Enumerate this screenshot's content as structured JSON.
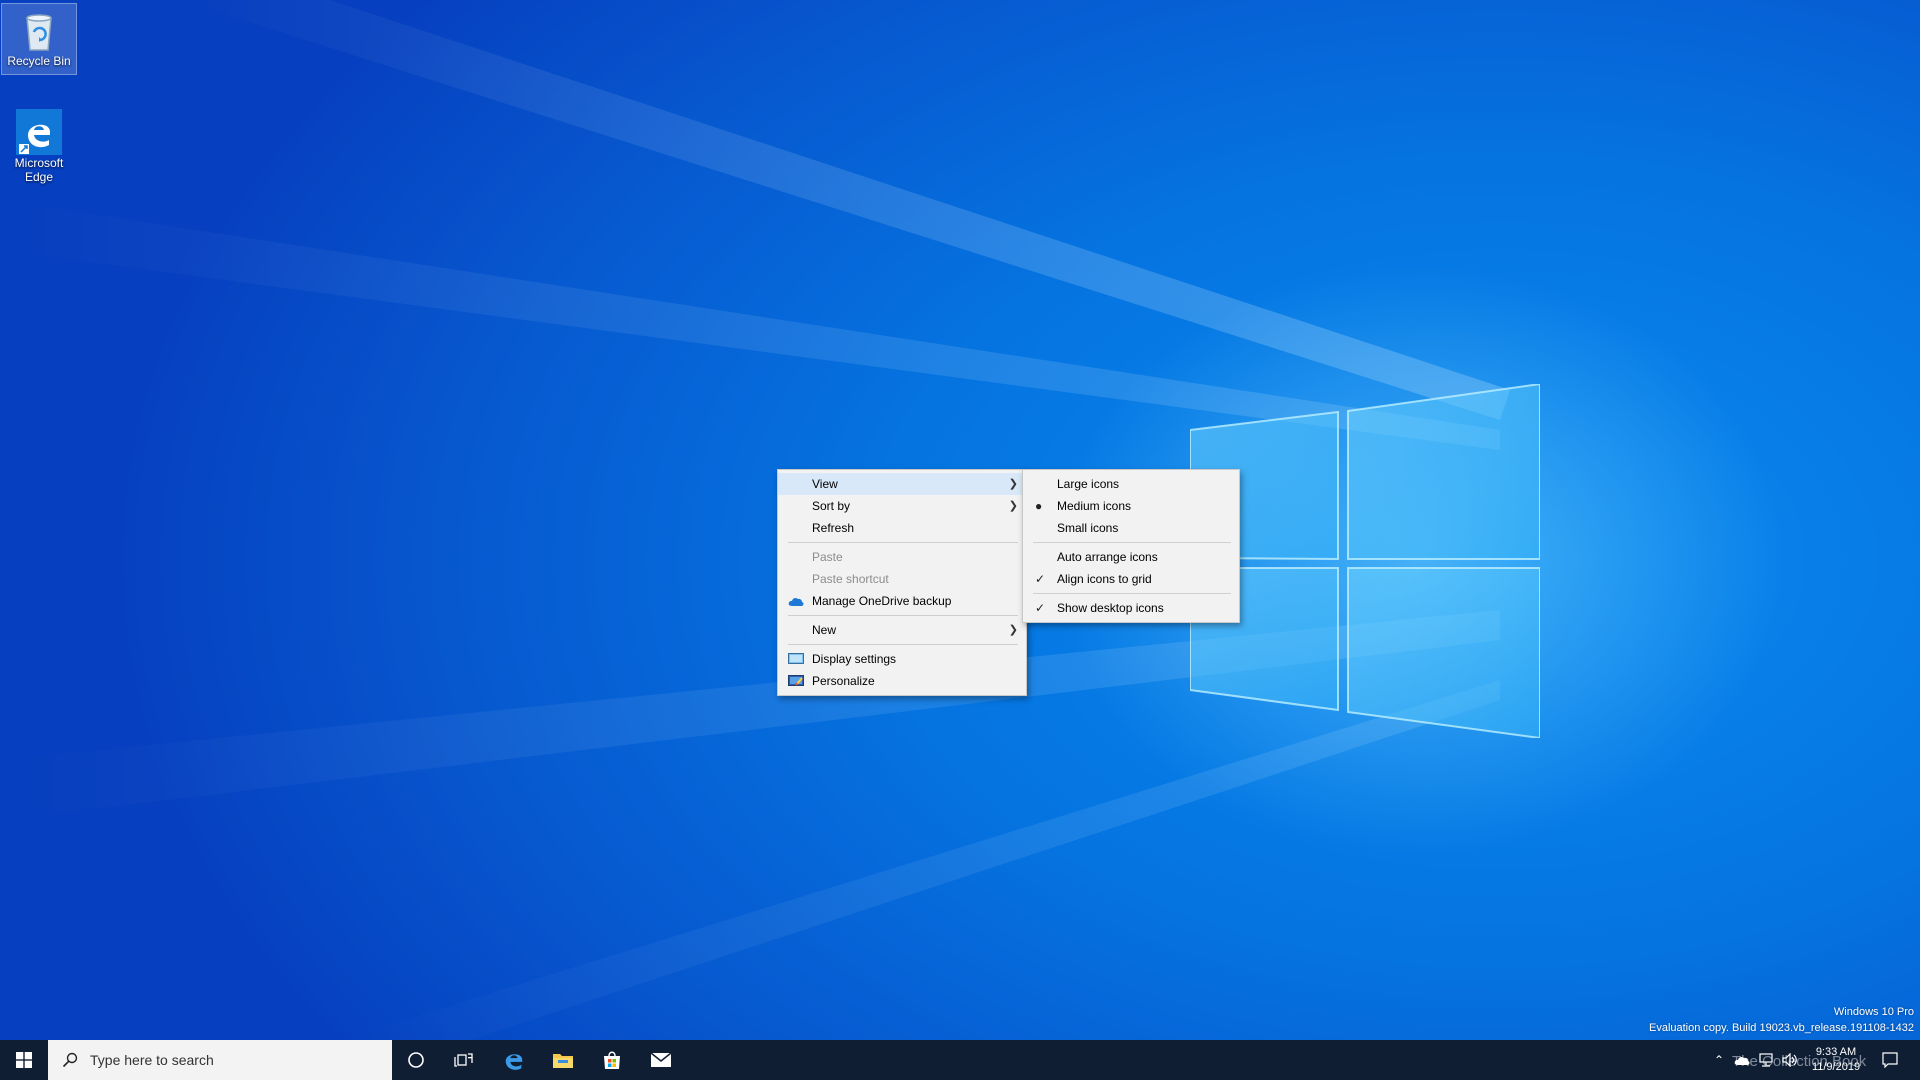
{
  "desktop": {
    "icons": [
      {
        "label": "Recycle Bin",
        "icon": "recycle-bin-icon"
      },
      {
        "label": "Microsoft Edge",
        "icon": "edge-icon"
      }
    ]
  },
  "context_menu": {
    "items": [
      {
        "label": "View"
      },
      {
        "label": "Sort by"
      },
      {
        "label": "Refresh"
      },
      {
        "label": "Paste"
      },
      {
        "label": "Paste shortcut"
      },
      {
        "label": "Manage OneDrive backup"
      },
      {
        "label": "New"
      },
      {
        "label": "Display settings"
      },
      {
        "label": "Personalize"
      }
    ],
    "submenu": {
      "items": [
        {
          "label": "Large icons"
        },
        {
          "label": "Medium icons",
          "selected": true
        },
        {
          "label": "Small icons"
        },
        {
          "label": "Auto arrange icons",
          "checked": false
        },
        {
          "label": "Align icons to grid",
          "checked": true
        },
        {
          "label": "Show desktop icons",
          "checked": true
        }
      ],
      "radio_mark": "●",
      "check_mark": "✓"
    }
  },
  "taskbar": {
    "search_placeholder": "Type here to search",
    "pinned": [
      "cortana-icon",
      "task-view-icon",
      "edge-icon",
      "file-explorer-icon",
      "store-icon",
      "mail-icon"
    ],
    "clock": {
      "time": "9:33 AM",
      "date": "11/9/2019"
    }
  },
  "watermark": {
    "line1": "Windows 10 Pro",
    "line2": "Evaluation copy. Build 19023.vb_release.191108-1432",
    "overlay": "The Collection Book"
  },
  "colors": {
    "taskbar": "#101e34",
    "menu_bg": "#f2f2f2",
    "menu_hover": "#d9e8f8",
    "desktop_accent": "#0873e1"
  }
}
